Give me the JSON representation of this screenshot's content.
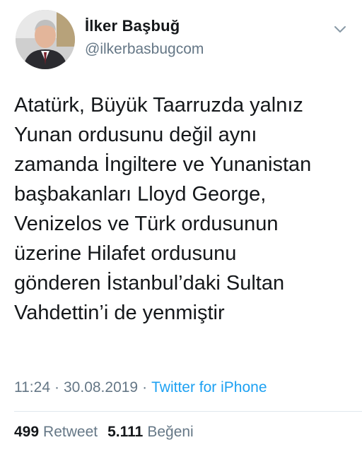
{
  "author": {
    "name": "İlker Başbuğ",
    "handle": "@ilkerbasbugcom"
  },
  "tweet": {
    "lines": [
      "Atatürk, Büyük Taarruzda yalnız",
      "Yunan ordusunu değil aynı",
      "zamanda İngiltere ve Yunanistan",
      "başbakanları Lloyd George,",
      "Venizelos ve Türk ordusunun",
      "üzerine Hilafet ordusunu",
      "gönderen İstanbul’daki Sultan",
      "Vahdettin’i de yenmiştir"
    ]
  },
  "meta": {
    "time": "11:24",
    "separator": "·",
    "date": "30.08.2019",
    "source": "Twitter for iPhone"
  },
  "stats": {
    "retweets_count": "499",
    "retweets_label": "Retweet",
    "likes_count": "5.111",
    "likes_label": "Beğeni"
  },
  "icons": {
    "menu": "chevron-down-icon"
  },
  "colors": {
    "link": "#1da1f2",
    "secondary_text": "#657786",
    "primary_text": "#14171a"
  }
}
